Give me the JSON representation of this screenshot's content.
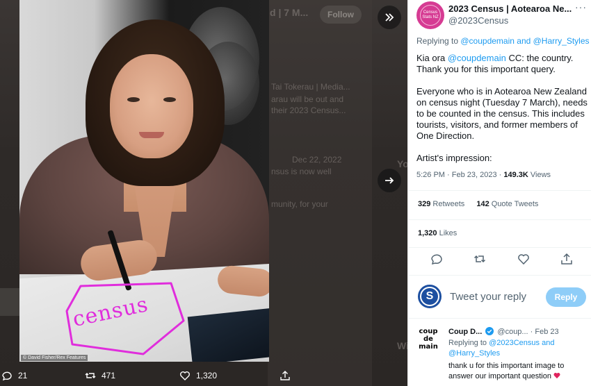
{
  "media": {
    "photo_credit": "© David Fisher/Rex Features",
    "overlay_word": "census",
    "background_follow": "Follow",
    "background_texts": [
      "d | 7 M...",
      "Tai Tokerau | Media...",
      "arau will be out and",
      "their 2023 Census...",
      "Dec 22, 2022",
      "nsus is now well",
      "munity, for your",
      "Yo",
      "Wi"
    ],
    "stats": {
      "replies": "21",
      "retweets": "471",
      "likes": "1,320"
    }
  },
  "tweet": {
    "display_name": "2023 Census | Aotearoa Ne...",
    "handle": "@2023Census",
    "avatar_label": "Census Stats NZ",
    "replying_prefix": "Replying to ",
    "replying_users": "@coupdemain and @Harry_Styles",
    "body_intro": "Kia ora ",
    "body_mention": "@coupdemain",
    "body_rest": " CC: the country. Thank you for this important query.",
    "body_para2": "Everyone who is in Aotearoa New Zealand on census night (Tuesday 7 March), needs to be counted in the census. This includes tourists, visitors, and former members of One Direction.",
    "body_para3": "Artist's impression:",
    "time": "5:26 PM · Feb 23, 2023 · ",
    "views_count": "149.3K",
    "views_label": " Views",
    "retweets_count": "329",
    "retweets_label": " Retweets",
    "quote_count": "142",
    "quote_label": " Quote Tweets",
    "likes_count": "1,320",
    "likes_label": " Likes"
  },
  "composer": {
    "avatar_letter": "S",
    "placeholder": "Tweet your reply",
    "button": "Reply"
  },
  "reply": {
    "avatar_text": "coup de main",
    "name": "Coup D...",
    "handle_time": "@coup... · Feb 23",
    "replying_prefix": "Replying to ",
    "replying_users": "@2023Census and @Harry_Styles",
    "text": "thank u for this important image to answer our important question"
  },
  "colors": {
    "accent": "#1d9bf0",
    "census_pink": "#d63b93",
    "marker_magenta": "#e02ddc"
  }
}
